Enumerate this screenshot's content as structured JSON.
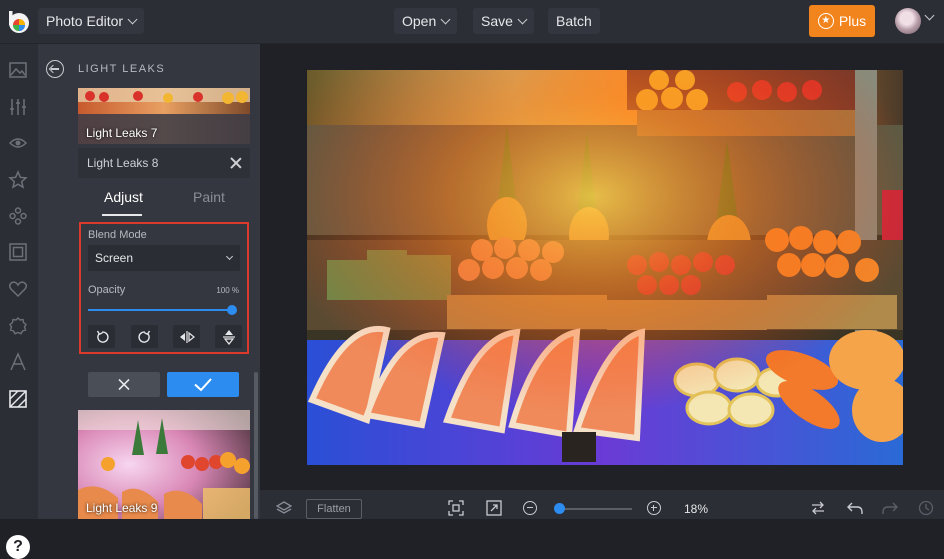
{
  "topbar": {
    "app_menu": "Photo Editor",
    "open_label": "Open",
    "save_label": "Save",
    "batch_label": "Batch",
    "plus_label": "Plus"
  },
  "rail": {
    "icons": [
      "image-icon",
      "sliders-icon",
      "eye-icon",
      "star-icon",
      "shapes-icon",
      "frame-icon",
      "heart-icon",
      "gear-icon",
      "text-icon",
      "texture-icon"
    ],
    "help_label": "?"
  },
  "panel": {
    "title": "LIGHT LEAKS",
    "thumb_top_label": "Light Leaks 7",
    "selected_layer": "Light Leaks 8",
    "tabs": {
      "adjust": "Adjust",
      "paint": "Paint"
    },
    "blend_mode_label": "Blend Mode",
    "blend_mode_value": "Screen",
    "opacity_label": "Opacity",
    "opacity_value": "100 %",
    "opacity_fraction": 1.0,
    "thumb_bottom_label": "Light Leaks 9"
  },
  "bottombar": {
    "flatten_label": "Flatten",
    "zoom_value": "18%"
  },
  "colors": {
    "accent": "#2d8cf0",
    "plus": "#f2841d",
    "highlight_border": "#d93a2b"
  }
}
